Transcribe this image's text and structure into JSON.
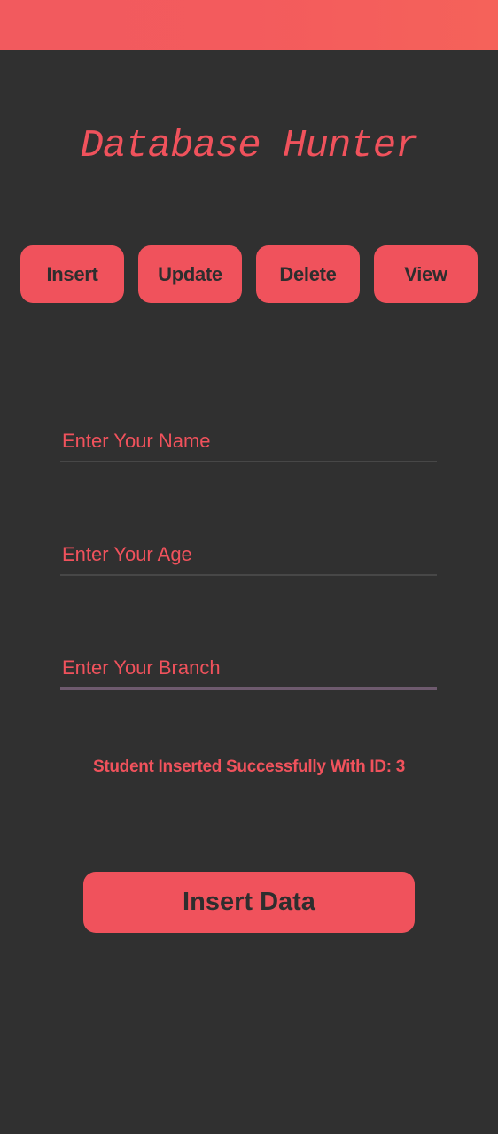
{
  "app": {
    "title": "Database Hunter"
  },
  "nav": {
    "buttons": [
      {
        "label": "Insert"
      },
      {
        "label": "Update"
      },
      {
        "label": "Delete"
      },
      {
        "label": "View"
      }
    ]
  },
  "form": {
    "name": {
      "placeholder": "Enter Your Name",
      "value": ""
    },
    "age": {
      "placeholder": "Enter Your Age",
      "value": ""
    },
    "branch": {
      "placeholder": "Enter Your Branch",
      "value": ""
    }
  },
  "status": {
    "message": "Student Inserted Successfully With ID: 3"
  },
  "actions": {
    "submit_label": "Insert Data"
  },
  "colors": {
    "accent": "#f0525c",
    "background": "#303030",
    "button_text": "#2e2e2e"
  }
}
